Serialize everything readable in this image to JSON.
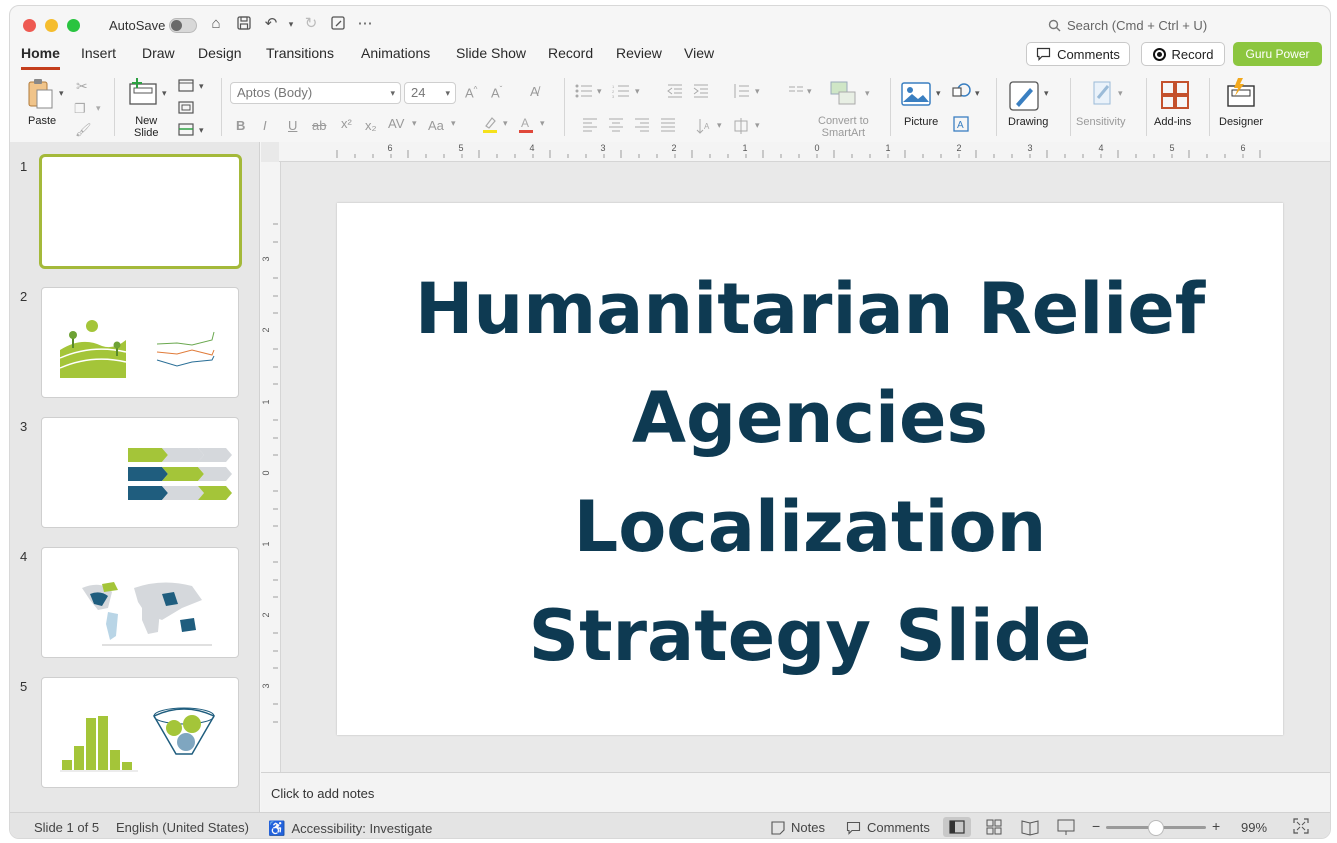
{
  "titlebar": {
    "autosave_label": "AutoSave",
    "search_placeholder": "Search (Cmd + Ctrl + U)"
  },
  "tabs": [
    {
      "label": "Home",
      "active": true
    },
    {
      "label": "Insert"
    },
    {
      "label": "Draw"
    },
    {
      "label": "Design"
    },
    {
      "label": "Transitions"
    },
    {
      "label": "Animations"
    },
    {
      "label": "Slide Show"
    },
    {
      "label": "Record"
    },
    {
      "label": "Review"
    },
    {
      "label": "View"
    }
  ],
  "actions": {
    "comments": "Comments",
    "record": "Record",
    "guru": "Guru Power"
  },
  "ribbon": {
    "paste": "Paste",
    "new_slide_line1": "New",
    "new_slide_line2": "Slide",
    "font_name": "Aptos (Body)",
    "font_size": "24",
    "convert_line1": "Convert to",
    "convert_line2": "SmartArt",
    "picture": "Picture",
    "drawing": "Drawing",
    "sensitivity": "Sensitivity",
    "addins": "Add-ins",
    "designer": "Designer"
  },
  "thumbnails": [
    {
      "num": "1"
    },
    {
      "num": "2"
    },
    {
      "num": "3"
    },
    {
      "num": "4"
    },
    {
      "num": "5"
    }
  ],
  "slide": {
    "title_lines": [
      "Humanitarian Relief",
      "Agencies",
      "Localization",
      "Strategy Slide"
    ]
  },
  "notes": {
    "placeholder": "Click to add notes"
  },
  "status": {
    "slide_info": "Slide 1 of 5",
    "language": "English (United States)",
    "accessibility": "Accessibility: Investigate",
    "notes": "Notes",
    "comments": "Comments",
    "zoom": "99%"
  },
  "colors": {
    "title": "#0e3a52",
    "accent_tab": "#c43e1c",
    "guru": "#8cc63f",
    "thumb_selected": "#a4b93a"
  }
}
